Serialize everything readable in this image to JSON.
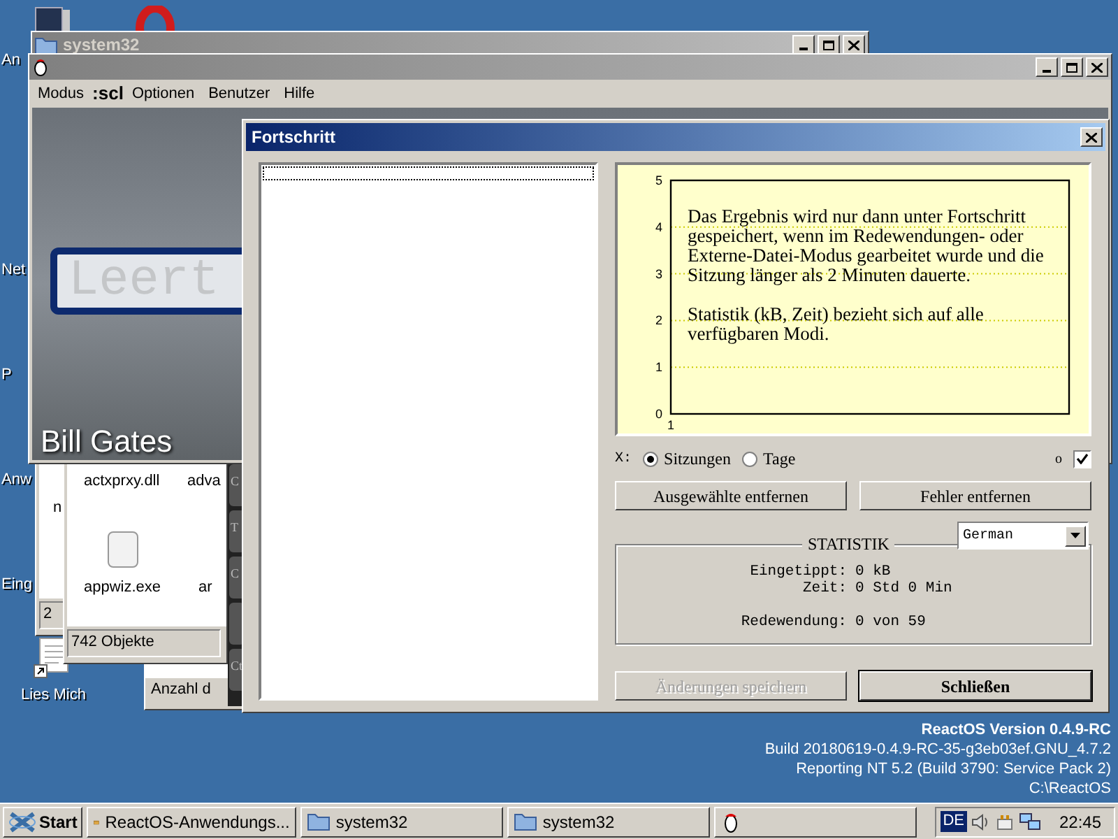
{
  "desktop": {
    "icon_labels": [
      {
        "label": "An"
      },
      {
        "label": "Net"
      },
      {
        "label": "P"
      },
      {
        "label": "Anw"
      },
      {
        "label": "Eing"
      }
    ],
    "readme": {
      "label": "Lies Mich"
    },
    "version_info": [
      "ReactOS Version 0.4.9-RC",
      "Build 20180619-0.4.9-RC-35-g3eb03ef.GNU_4.7.2",
      "Reporting NT 5.2 (Build 3790: Service Pack 2)",
      "C:\\ReactOS"
    ]
  },
  "back_windows": {
    "title": "system32",
    "left_text": "n",
    "left_status": "2",
    "explorer": {
      "files": [
        {
          "label": "actxprxy.dll"
        },
        {
          "label": "adva"
        },
        {
          "label": "appwiz.exe"
        },
        {
          "label": "ar"
        }
      ],
      "status": "742 Objekte"
    },
    "lower_status": "Anzahl d",
    "keys": [
      {
        "kind": "key",
        "label": "C"
      },
      {
        "kind": "key",
        "label": "T"
      },
      {
        "kind": "key",
        "label": "C"
      },
      {
        "kind": "blank"
      },
      {
        "kind": "key",
        "label": "Ct"
      }
    ]
  },
  "app_window": {
    "menu": [
      "Modus",
      ":scl",
      "Optionen",
      "Benutzer",
      "Hilfe"
    ],
    "field_text": "Leert",
    "caption": "Bill Gates"
  },
  "dialog": {
    "title": "Fortschritt",
    "chart": {
      "y_ticks": [
        "5",
        "4",
        "3",
        "2",
        "1",
        "0"
      ],
      "x_ticks": [
        "1"
      ],
      "message": [
        "Das Ergebnis wird nur dann unter Fortschritt gespeichert, wenn im Redewendungen- oder Externe-Datei-Modus gearbeitet wurde und die Sitzung länger als 2 Minuten dauerte.",
        "Statistik (kB, Zeit) bezieht sich auf alle verfügbaren Modi."
      ]
    },
    "x_label": "X:",
    "x_options": [
      {
        "label": "Sitzungen",
        "selected": true
      },
      {
        "label": "Tage",
        "selected": false
      }
    ],
    "small_label": "o",
    "toggle_checked": true,
    "buttons": [
      {
        "label": "Ausgewählte entfernen",
        "disabled": false
      },
      {
        "label": "Fehler entfernen",
        "disabled": false
      }
    ],
    "stats": {
      "title": "STATISTIK",
      "language": "German",
      "rows": [
        {
          "label": "Eingetippt:",
          "value": "0 kB"
        },
        {
          "label": "Zeit:",
          "value": "0 Std 0 Min"
        },
        {
          "kind": "gap"
        },
        {
          "label": "Redewendung:",
          "value": "0 von 59"
        }
      ]
    },
    "footer_buttons": [
      {
        "label": "Änderungen speichern",
        "disabled": true,
        "default": false
      },
      {
        "label": "Schließen",
        "disabled": false,
        "default": true
      }
    ]
  },
  "taskbar": {
    "start": "Start",
    "tasks": [
      {
        "label": "ReactOS-Anwendungs...",
        "kind": "app"
      },
      {
        "label": "system32",
        "kind": "folder"
      },
      {
        "label": "system32",
        "kind": "folder"
      },
      {
        "kind": "icon_only"
      }
    ],
    "language": "DE",
    "clock": "22:45"
  }
}
